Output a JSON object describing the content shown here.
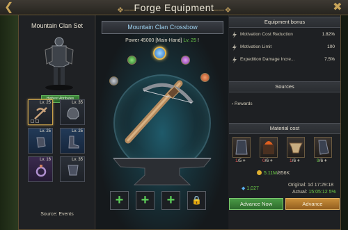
{
  "window": {
    "title": "Forge Equipment"
  },
  "set": {
    "title": "Mountain Clan Set",
    "highest_label": "Highest Attributes",
    "source": "Source: Events"
  },
  "slots": [
    {
      "lv": "Lv. 25"
    },
    {
      "lv": "Lv. 35"
    },
    {
      "lv": "Lv. 25"
    },
    {
      "lv": "Lv. 25"
    },
    {
      "lv": "Lv. 16"
    },
    {
      "lv": "Lv. 35"
    }
  ],
  "item": {
    "name": "Mountain Clan Crossbow",
    "power_label": "Power",
    "power_value": "45000",
    "slot": "[Main-Hand]",
    "level": "Lv. 25",
    "mark": "!"
  },
  "bonus": {
    "title": "Equipment bonus",
    "rows": [
      {
        "label": "Motivation Cost Reduction",
        "value": "1.82%",
        "icon": "bolt-icon"
      },
      {
        "label": "Motivation Limit",
        "value": "100",
        "icon": "bolt-icon"
      },
      {
        "label": "Expedition Damage Incre...",
        "value": "7.5%",
        "icon": "bolt-icon"
      }
    ]
  },
  "sources": {
    "title": "Sources",
    "rewards": "Rewards"
  },
  "materials": {
    "title": "Material cost",
    "items": [
      {
        "have": "1",
        "need": "5"
      },
      {
        "have": "0",
        "need": "6"
      },
      {
        "have": "1",
        "need": "6"
      },
      {
        "have": "9",
        "need": "6"
      }
    ],
    "gold_have": "5.11M",
    "gold_need": "856K",
    "gems": "1,027"
  },
  "time": {
    "original_label": "Original:",
    "original_value": "1d 17:29:18",
    "actual_label": "Actual:",
    "actual_value": "15:05:12",
    "actual_pct": "5%"
  },
  "buttons": {
    "advance_now": "Advance Now",
    "advance": "Advance"
  },
  "colors": {
    "accent_green": "#6fd04a",
    "accent_gold": "#e3b64a",
    "name_blue": "#9fd2f0",
    "red": "#e05050"
  }
}
